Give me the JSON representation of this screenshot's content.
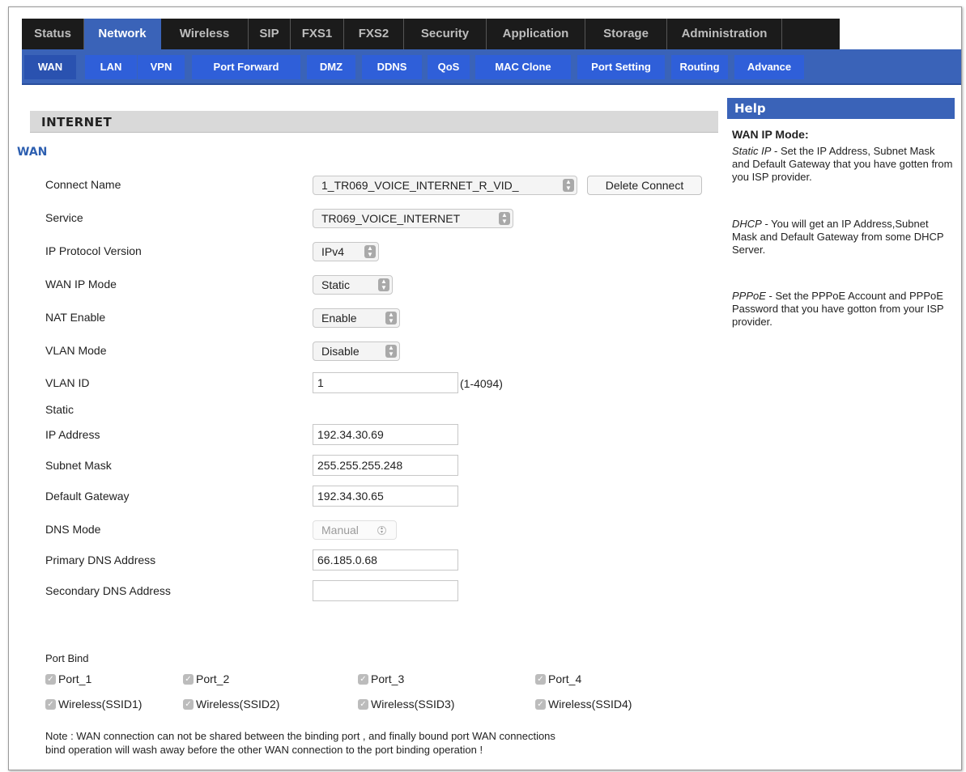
{
  "top_tabs": [
    {
      "label": "Status"
    },
    {
      "label": "Network"
    },
    {
      "label": "Wireless"
    },
    {
      "label": "SIP"
    },
    {
      "label": "FXS1"
    },
    {
      "label": "FXS2"
    },
    {
      "label": "Security"
    },
    {
      "label": "Application"
    },
    {
      "label": "Storage"
    },
    {
      "label": "Administration"
    }
  ],
  "sub_tabs": [
    {
      "label": "WAN"
    },
    {
      "label": "LAN"
    },
    {
      "label": "VPN"
    },
    {
      "label": "Port Forward"
    },
    {
      "label": "DMZ"
    },
    {
      "label": "DDNS"
    },
    {
      "label": "QoS"
    },
    {
      "label": "MAC Clone"
    },
    {
      "label": "Port Setting"
    },
    {
      "label": "Routing"
    },
    {
      "label": "Advance"
    }
  ],
  "section_title": "INTERNET",
  "subsection_title": "WAN",
  "form": {
    "connect_name": {
      "label": "Connect Name",
      "value": "1_TR069_VOICE_INTERNET_R_VID_"
    },
    "delete_button": "Delete Connect",
    "service": {
      "label": "Service",
      "value": "TR069_VOICE_INTERNET"
    },
    "ip_protocol": {
      "label": "IP Protocol Version",
      "value": "IPv4"
    },
    "wan_ip_mode": {
      "label": "WAN IP Mode",
      "value": "Static"
    },
    "nat_enable": {
      "label": "NAT Enable",
      "value": "Enable"
    },
    "vlan_mode": {
      "label": "VLAN Mode",
      "value": "Disable"
    },
    "vlan_id": {
      "label": "VLAN ID",
      "value": "1",
      "hint": "(1-4094)"
    },
    "static_label": "Static",
    "ip_address": {
      "label": "IP Address",
      "value": "192.34.30.69"
    },
    "subnet_mask": {
      "label": "Subnet Mask",
      "value": "255.255.255.248"
    },
    "default_gateway": {
      "label": "Default Gateway",
      "value": "192.34.30.65"
    },
    "dns_mode": {
      "label": "DNS Mode",
      "value": "Manual"
    },
    "primary_dns": {
      "label": "Primary DNS Address",
      "value": "66.185.0.68"
    },
    "secondary_dns": {
      "label": "Secondary DNS Address",
      "value": ""
    }
  },
  "port_bind": {
    "label": "Port Bind",
    "items": [
      {
        "label": "Port_1",
        "checked": true
      },
      {
        "label": "Port_2",
        "checked": true
      },
      {
        "label": "Port_3",
        "checked": true
      },
      {
        "label": "Port_4",
        "checked": true
      },
      {
        "label": "Wireless(SSID1)",
        "checked": true
      },
      {
        "label": "Wireless(SSID2)",
        "checked": true
      },
      {
        "label": "Wireless(SSID3)",
        "checked": true
      },
      {
        "label": "Wireless(SSID4)",
        "checked": true
      }
    ],
    "note_line1": "Note : WAN connection can not be shared between the binding port , and finally bound port WAN connections",
    "note_line2": "bind operation will wash away before the other WAN connection to the port binding operation !"
  },
  "help": {
    "title": "Help",
    "heading": "WAN IP Mode:",
    "static_term": "Static IP",
    "static_text": " - Set the IP Address, Subnet Mask and Default Gateway that you have gotten from you ISP provider.",
    "dhcp_term": "DHCP",
    "dhcp_text": " - You will get an IP Address,Subnet Mask and Default Gateway from some DHCP Server.",
    "pppoe_term": "PPPoE",
    "pppoe_text": " - Set the PPPoE Account and PPPoE Password that you have gotton from your ISP provider."
  },
  "colors": {
    "accent": "#3a63b8",
    "topnav_bg": "#1b1b1b",
    "subtab": "#2f5fd9"
  }
}
